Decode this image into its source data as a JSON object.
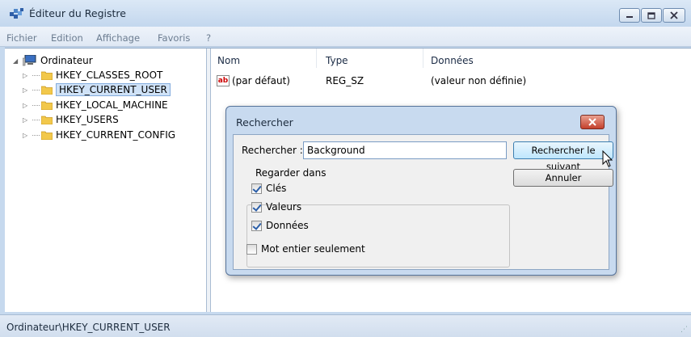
{
  "window": {
    "title": "Éditeur du Registre"
  },
  "menu": [
    "Fichier",
    "Edition",
    "Affichage",
    "Favoris",
    "?"
  ],
  "tree": {
    "root": "Ordinateur",
    "items": [
      "HKEY_CLASSES_ROOT",
      "HKEY_CURRENT_USER",
      "HKEY_LOCAL_MACHINE",
      "HKEY_USERS",
      "HKEY_CURRENT_CONFIG"
    ],
    "selected": "HKEY_CURRENT_USER"
  },
  "list": {
    "columns": [
      "Nom",
      "Type",
      "Données"
    ],
    "rows": [
      {
        "name": "(par défaut)",
        "type": "REG_SZ",
        "data": "(valeur non définie)",
        "icon": "string-value-icon"
      }
    ]
  },
  "status": "Ordinateur\\HKEY_CURRENT_USER",
  "dialog": {
    "title": "Rechercher",
    "search_label": "Rechercher :",
    "search_value": "Background",
    "find_next_label": "Rechercher le suivant",
    "cancel_label": "Annuler",
    "look_in_label": "Regarder dans",
    "checks": [
      {
        "label": "Clés",
        "checked": true
      },
      {
        "label": "Valeurs",
        "checked": true
      },
      {
        "label": "Données",
        "checked": true
      }
    ],
    "whole_word": {
      "label": "Mot entier seulement",
      "checked": false
    }
  },
  "colors": {
    "title_bg": "#c6d9ee",
    "selection": "#cfe2f7",
    "close_red": "#c4402c"
  }
}
